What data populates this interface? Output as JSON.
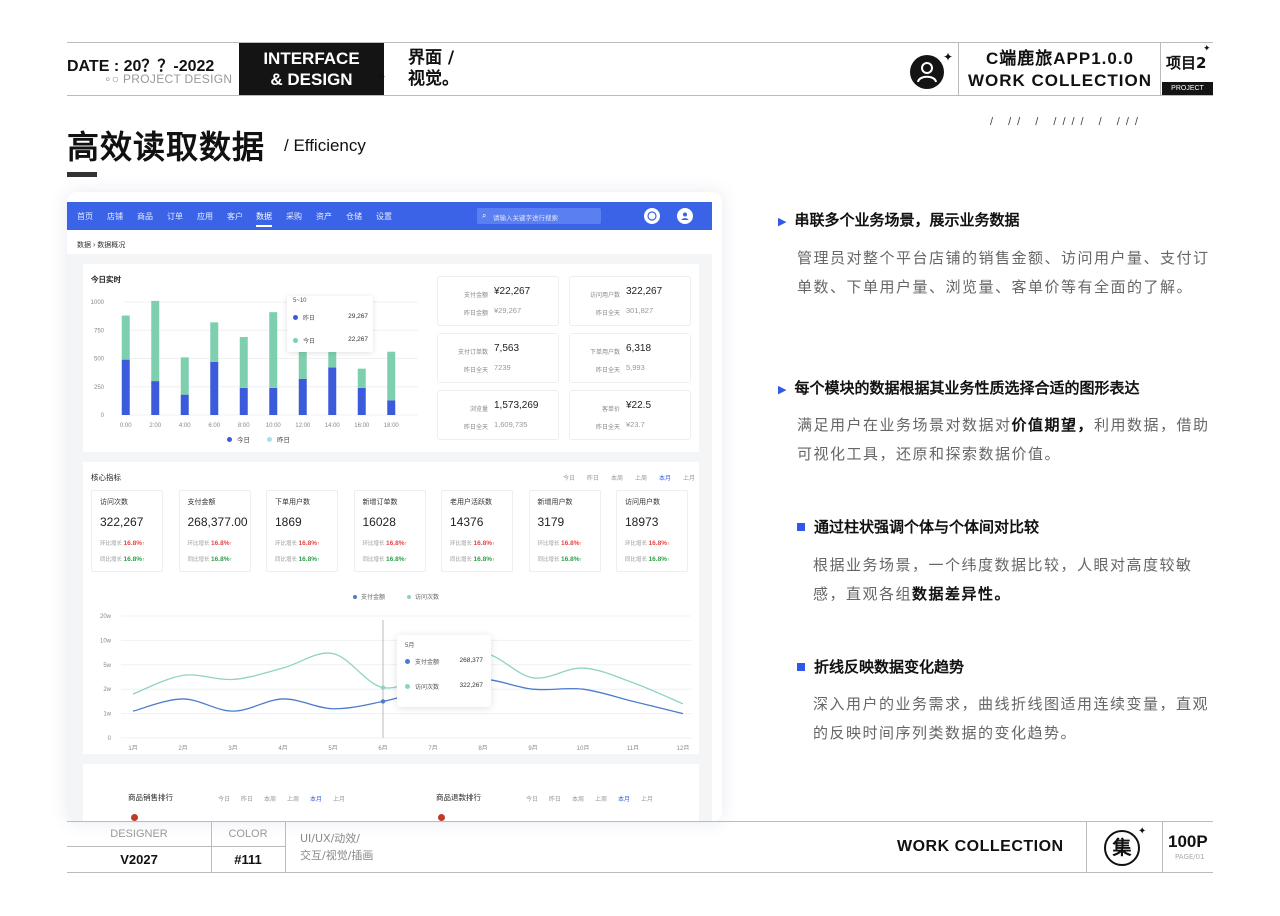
{
  "header": {
    "date": "DATE : 20？？-2022",
    "project_design": "∘○ PROJECT DESIGN",
    "interface_line1": "INTERFACE",
    "interface_line2": "& DESIGN",
    "jm_line1": "界面 /",
    "jm_line2": "视觉。",
    "app_name": "C端鹿旅APP1.0.0",
    "work_collection": "WORK  COLLECTION",
    "project_label": "项目2",
    "project_badge": "PROJECT"
  },
  "page": {
    "title": "高效读取数据",
    "subtitle": "/ Efficiency",
    "slashes": "/  //  /  ////  /  ///"
  },
  "mock": {
    "nav": [
      "首页",
      "店铺",
      "商品",
      "订单",
      "应用",
      "客户",
      "数据",
      "采购",
      "资产",
      "仓储",
      "设置"
    ],
    "active_nav": "数据",
    "search_placeholder": "请输入关键字进行搜索",
    "breadcrumb": "数据  ›  数据概况",
    "realtime": {
      "title": "今日实时",
      "yticks": [
        "1000",
        "750",
        "500",
        "250",
        "0"
      ],
      "xticks": [
        "0:00",
        "2:00",
        "4:00",
        "6:00",
        "8:00",
        "10:00",
        "12:00",
        "14:00",
        "16:00",
        "18:00"
      ],
      "legend_today": "今日",
      "legend_yesterday": "昨日",
      "tooltip": {
        "title": "5~10",
        "row1_label": "昨日",
        "row1_value": "29,267",
        "row2_label": "今日",
        "row2_value": "22,267"
      }
    },
    "stats": [
      {
        "label1": "支付金额",
        "value": "¥22,267",
        "label2": "昨日金额",
        "sub": "¥29,267"
      },
      {
        "label1": "访问用户数",
        "value": "322,267",
        "label2": "昨日全天",
        "sub": "301,827"
      },
      {
        "label1": "支付订单数",
        "value": "7,563",
        "label2": "昨日全天",
        "sub": "7239"
      },
      {
        "label1": "下单用户数",
        "value": "6,318",
        "label2": "昨日全天",
        "sub": "5,993"
      },
      {
        "label1": "浏览量",
        "value": "1,573,269",
        "label2": "昨日全天",
        "sub": "1,609,735"
      },
      {
        "label1": "客单价",
        "value": "¥22.5",
        "label2": "昨日全天",
        "sub": "¥23.7"
      }
    ],
    "core": {
      "title": "核心指标",
      "periods": [
        "今日",
        "昨日",
        "本周",
        "上周",
        "本月",
        "上月"
      ],
      "active_period": "本月",
      "kpis": [
        {
          "label": "访问次数",
          "value": "322,267"
        },
        {
          "label": "支付金额",
          "value": "268,377.00"
        },
        {
          "label": "下单用户数",
          "value": "1869"
        },
        {
          "label": "新增订单数",
          "value": "16028"
        },
        {
          "label": "老用户活跃数",
          "value": "14376"
        },
        {
          "label": "新增用户数",
          "value": "3179"
        },
        {
          "label": "访问用户数",
          "value": "18973"
        }
      ],
      "ring_label": "环比增长",
      "ring_value": "16.8%",
      "yoy_label": "同比增长",
      "yoy_value": "16.8%",
      "legend_pay": "支付金额",
      "legend_visit": "访问次数",
      "line_yticks": [
        "20w",
        "10w",
        "5w",
        "2w",
        "1w",
        "0"
      ],
      "line_xticks": [
        "1月",
        "2月",
        "3月",
        "4月",
        "5月",
        "6月",
        "7月",
        "8月",
        "9月",
        "10月",
        "11月",
        "12月"
      ],
      "tooltip": {
        "title": "5月",
        "row1_label": "支付金额",
        "row1_value": "268,377",
        "row2_label": "访问次数",
        "row2_value": "322,267"
      }
    },
    "rank": {
      "left_title": "商品销售排行",
      "right_title": "商品退款排行",
      "left_periods": [
        "今日",
        "昨日",
        "本周",
        "上周",
        "本月",
        "上月"
      ],
      "right_periods": [
        "今日",
        "昨日",
        "本周",
        "上周",
        "本月",
        "上月"
      ],
      "active_period": "本月"
    }
  },
  "sections": [
    {
      "heading": "串联多个业务场景，展示业务数据",
      "text": "管理员对整个平台店铺的销售金额、访问用户量、支付订单数、下单用户量、浏览量、客单价等有全面的了解。"
    },
    {
      "heading": "每个模块的数据根据其业务性质选择合适的图形表达",
      "text_a": "满足用户在业务场景对数据对",
      "text_bold": "价值期望，",
      "text_b": "利用数据，借助可视化工具，还原和探索数据价值。"
    },
    {
      "heading": "通过柱状强调个体与个体间对比较",
      "text_a": "根据业务场景，一个纬度数据比较，人眼对高度较敏感，直观各组",
      "text_bold": "数据差异性。"
    },
    {
      "heading": "折线反映数据变化趋势",
      "text": "深入用户的业务需求，曲线折线图适用连续变量，直观的反映时间序列类数据的变化趋势。"
    }
  ],
  "footer": {
    "designer_label": "DESIGNER",
    "designer_value": "V2027",
    "color_label": "COLOR",
    "color_value": "#111",
    "tags_line1": "UI/UX/动效/",
    "tags_line2": "交互/视觉/插画",
    "work_collection": "WORK  COLLECTION",
    "logo_char": "集",
    "page_num": "100P",
    "page_sub": "PAGE/01"
  },
  "chart_data": [
    {
      "type": "bar",
      "title": "今日实时",
      "categories": [
        "0:00",
        "2:00",
        "4:00",
        "6:00",
        "8:00",
        "10:00",
        "12:00",
        "14:00",
        "16:00",
        "18:00"
      ],
      "ylim": [
        0,
        1000
      ],
      "stacked": true,
      "series": [
        {
          "name": "今日",
          "color": "#3b5bdb",
          "values": [
            490,
            300,
            180,
            470,
            240,
            240,
            320,
            420,
            240,
            130
          ]
        },
        {
          "name": "昨日",
          "color": "#7ecfae",
          "values": [
            390,
            710,
            330,
            350,
            450,
            670,
            290,
            480,
            170,
            430
          ]
        }
      ]
    },
    {
      "type": "line",
      "x": [
        "1月",
        "2月",
        "3月",
        "4月",
        "5月",
        "6月",
        "7月",
        "8月",
        "9月",
        "10月",
        "11月",
        "12月"
      ],
      "yticks": [
        "0",
        "1w",
        "2w",
        "5w",
        "10w",
        "20w"
      ],
      "series": [
        {
          "name": "支付金额",
          "color": "#4a7bd0",
          "values": [
            1.1,
            1.6,
            1.1,
            1.6,
            1.2,
            1.5,
            2.1,
            3.2,
            2.0,
            2.0,
            1.5,
            1.0
          ]
        },
        {
          "name": "访问次数",
          "color": "#8fd3c1",
          "values": [
            1.8,
            3.7,
            3.2,
            4.6,
            7.3,
            2.2,
            4.2,
            7.4,
            3.4,
            4.6,
            2.8,
            1.4
          ]
        }
      ]
    }
  ]
}
